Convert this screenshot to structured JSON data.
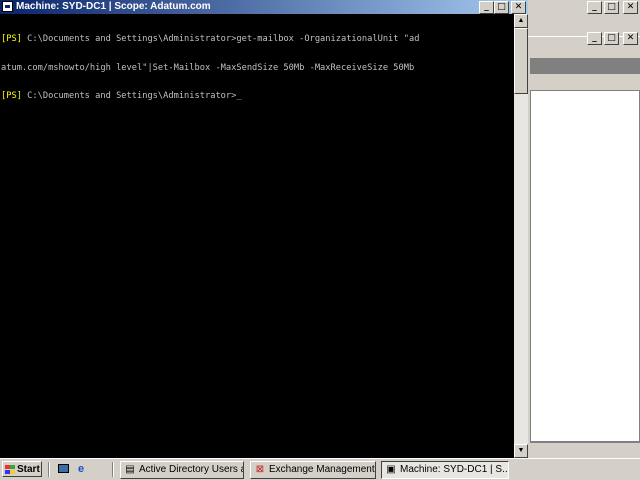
{
  "console": {
    "title": "Machine: SYD-DC1 | Scope: Adatum.com",
    "lines": [
      {
        "prompt": "[PS]",
        "text": " C:\\Documents and Settings\\Administrator>get-mailbox -OrganizationalUnit \"ad"
      },
      {
        "prompt": "",
        "text": "atum.com/mshowto/high level\"|Set-Mailbox -MaxSendSize 50Mb -MaxReceiveSize 50Mb"
      },
      {
        "prompt": "[PS]",
        "text": " C:\\Documents and Settings\\Administrator>"
      }
    ],
    "cursor": "_"
  },
  "window_buttons": {
    "minimize": "_",
    "maximize": "□",
    "close": "✕"
  },
  "scrollbar": {
    "up": "▲",
    "down": "▼"
  },
  "taskbar": {
    "start_label": "Start",
    "items": [
      {
        "label": "Active Directory Users a...",
        "icon": "folder-people-icon"
      },
      {
        "label": "Exchange Management ...",
        "icon": "exchange-icon"
      },
      {
        "label": "Machine: SYD-DC1 | S...",
        "icon": "console-icon",
        "active": true
      }
    ]
  },
  "colors": {
    "title_bar_start": "#0a246a",
    "title_bar_end": "#a6caf0",
    "console_bg": "#000000",
    "prompt": "#ffff00",
    "console_text": "#c0c0c0",
    "desktop": "#3a6ea5"
  }
}
